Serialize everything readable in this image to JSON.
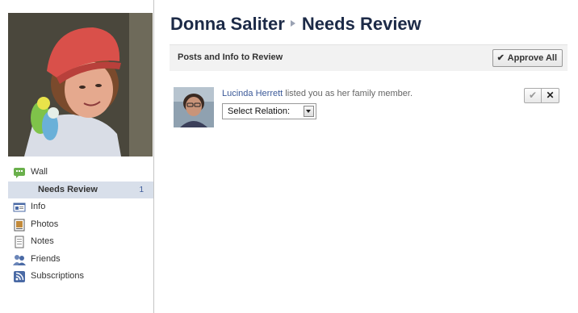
{
  "header": {
    "profile_name": "Donna Saliter",
    "page_title": "Needs Review"
  },
  "sidebar": {
    "items": [
      {
        "label": "Wall",
        "icon": "wall-icon"
      },
      {
        "label": "Needs Review",
        "count": "1"
      },
      {
        "label": "Info",
        "icon": "info-icon"
      },
      {
        "label": "Photos",
        "icon": "photos-icon"
      },
      {
        "label": "Notes",
        "icon": "notes-icon"
      },
      {
        "label": "Friends",
        "icon": "friends-icon"
      },
      {
        "label": "Subscriptions",
        "icon": "subscriptions-icon"
      }
    ]
  },
  "review": {
    "header_title": "Posts and Info to Review",
    "approve_all_label": "Approve All",
    "story": {
      "actor_name": "Lucinda Herrett",
      "message": " listed you as her family member.",
      "select_value": "Select Relation:"
    }
  },
  "colors": {
    "link": "#3b5998",
    "title": "#1c2a47",
    "selected_nav_bg": "#d8dfea",
    "header_bg": "#f2f2f2"
  }
}
